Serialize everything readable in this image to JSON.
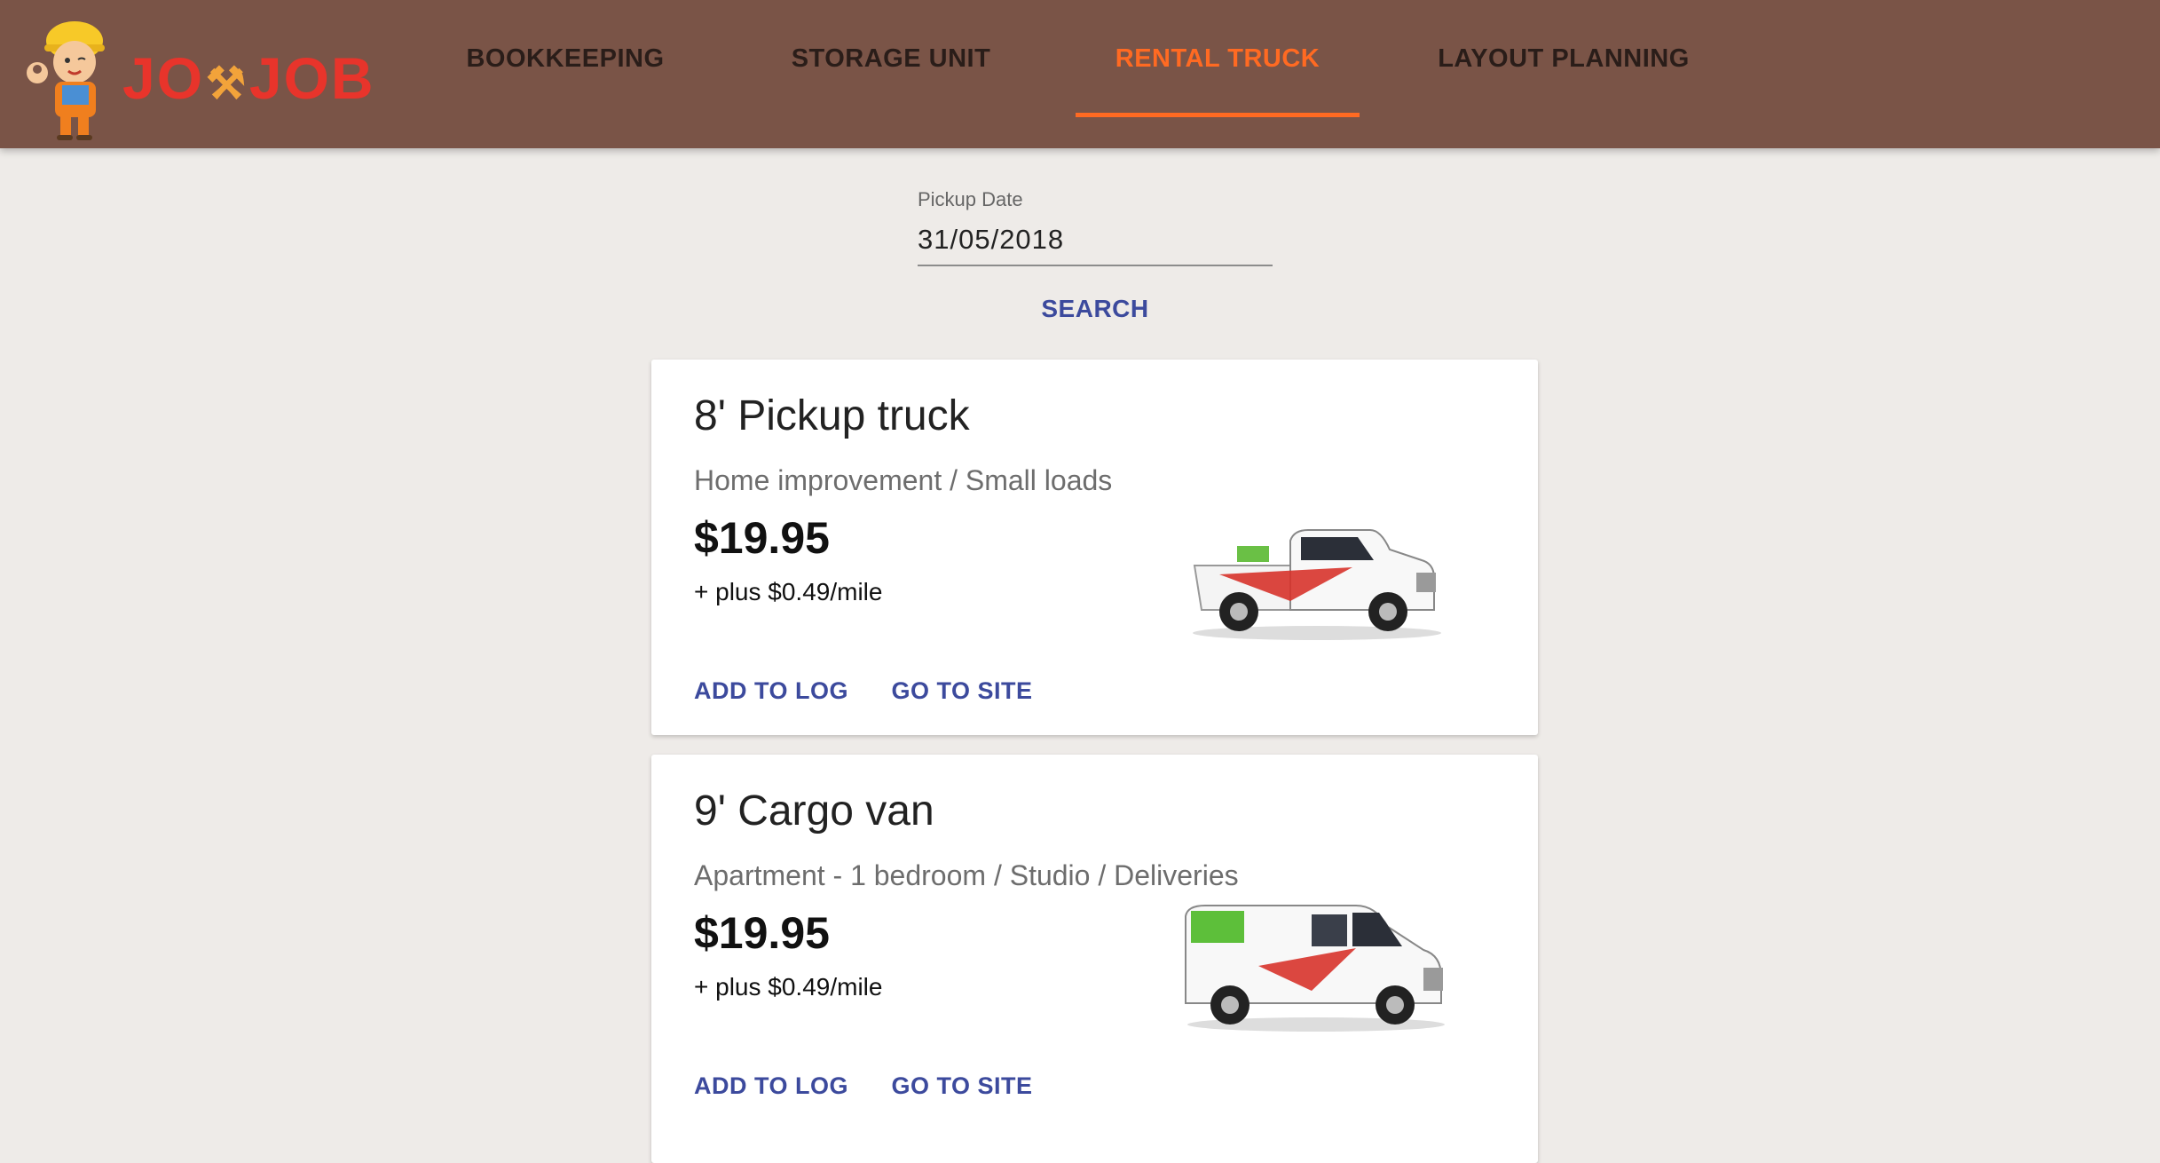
{
  "app": {
    "logo_text_left": "JO",
    "logo_text_right": "JOB",
    "logo_tools": "⚒"
  },
  "nav": {
    "tabs": [
      {
        "label": "BOOKKEEPING",
        "active": false
      },
      {
        "label": "STORAGE UNIT",
        "active": false
      },
      {
        "label": "RENTAL TRUCK",
        "active": true
      },
      {
        "label": "LAYOUT PLANNING",
        "active": false
      }
    ]
  },
  "search": {
    "date_label": "Pickup Date",
    "date_value": "31/05/2018",
    "button_label": "SEARCH"
  },
  "colors": {
    "header_bg": "#7a5447",
    "accent": "#ff6a22",
    "action_blue": "#3c4a9d",
    "page_bg": "#eeebe8"
  },
  "vehicles": [
    {
      "title": "8' Pickup truck",
      "subtitle": "Home improvement / Small loads",
      "price": "$19.95",
      "rate": "+ plus $0.49/mile",
      "add_label": "ADD TO LOG",
      "site_label": "GO TO SITE",
      "image": "pickup-truck-image"
    },
    {
      "title": "9' Cargo van",
      "subtitle": "Apartment - 1 bedroom / Studio / Deliveries",
      "price": "$19.95",
      "rate": "+ plus $0.49/mile",
      "add_label": "ADD TO LOG",
      "site_label": "GO TO SITE",
      "image": "cargo-van-image"
    }
  ]
}
